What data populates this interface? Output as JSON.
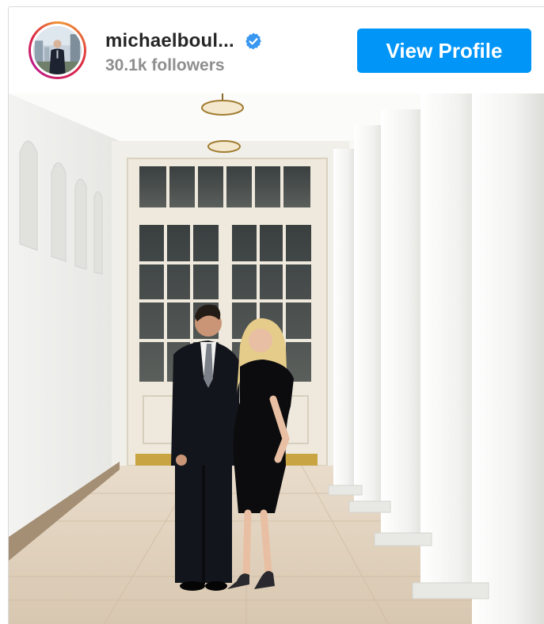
{
  "post_header": {
    "username": "michaelboul...",
    "followers": "30.1k followers",
    "view_profile_label": "View Profile",
    "verified_icon": "verified-badge-icon",
    "accent_color": "#0095f6",
    "verified_color": "#3897f0"
  },
  "post_image": {
    "icon": "photo-couple-colonnade"
  }
}
